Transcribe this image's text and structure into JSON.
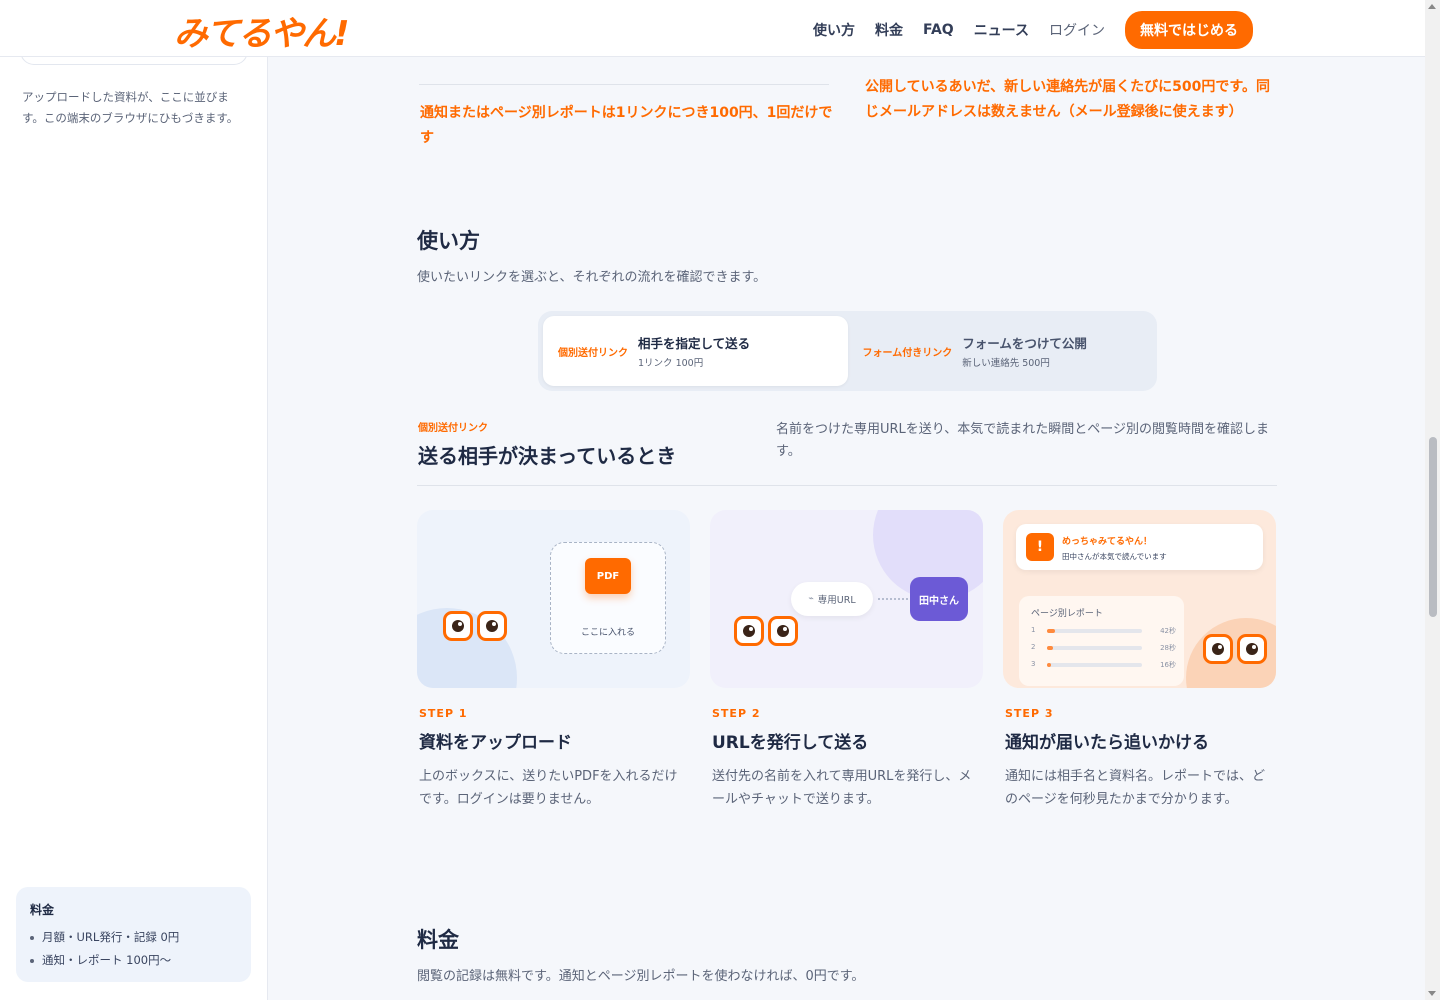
{
  "header": {
    "logo": "みてるやん!",
    "nav": [
      "使い方",
      "料金",
      "FAQ",
      "ニュース"
    ],
    "login": "ログイン",
    "cta": "無料ではじめる"
  },
  "sidebar": {
    "note": "アップロードした資料が、ここに並びます。この端末のブラウザにひもづきます。",
    "price": {
      "title": "料金",
      "items": [
        "月額・URL発行・記録 0円",
        "通知・レポート 100円〜"
      ]
    }
  },
  "notes": {
    "left": "通知またはページ別レポートは1リンクにつき100円、1回だけです",
    "right": "公開しているあいだ、新しい連絡先が届くたびに500円です。同じメールアドレスは数えません（メール登録後に使えます）"
  },
  "howto": {
    "title": "使い方",
    "subtitle": "使いたいリンクを選ぶと、それぞれの流れを確認できます。",
    "tabs": [
      {
        "tag": "個別送付リンク",
        "title": "相手を指定して送る",
        "sub": "1リンク 100円"
      },
      {
        "tag": "フォーム付きリンク",
        "title": "フォームをつけて公開",
        "sub": "新しい連絡先 500円"
      }
    ],
    "flow": {
      "tag": "個別送付リンク",
      "title": "送る相手が決まっているとき",
      "desc": "名前をつけた専用URLを送り、本気で読まれた瞬間とページ別の閲覧時間を確認します。"
    },
    "steps": [
      {
        "label": "STEP 1",
        "title": "資料をアップロード",
        "desc": "上のボックスに、送りたいPDFを入れるだけです。ログインは要りません。"
      },
      {
        "label": "STEP 2",
        "title": "URLを発行して送る",
        "desc": "送付先の名前を入れて専用URLを発行し、メールやチャットで送ります。"
      },
      {
        "label": "STEP 3",
        "title": "通知が届いたら追いかける",
        "desc": "通知には相手名と資料名。レポートでは、どのページを何秒見たかまで分かります。"
      }
    ],
    "illus": {
      "pdf": "PDF",
      "drop_label": "ここに入れる",
      "url_pill": "専用URL",
      "recipient": "田中さん",
      "notif_title": "めっちゃみてるやん！",
      "notif_sub": "田中さんが本気で読んでいます",
      "report_title": "ページ別レポート",
      "report_rows": [
        {
          "page": "1",
          "seconds": "42秒",
          "fill": 0.08
        },
        {
          "page": "2",
          "seconds": "28秒",
          "fill": 0.06
        },
        {
          "page": "3",
          "seconds": "16秒",
          "fill": 0.04
        }
      ]
    }
  },
  "pricing": {
    "title": "料金",
    "subtitle": "閲覧の記録は無料です。通知とページ別レポートを使わなければ、0円です。"
  },
  "colors": {
    "accent": "#ff6a00",
    "purple": "#6c5ad6",
    "text": "#1f2a44"
  }
}
